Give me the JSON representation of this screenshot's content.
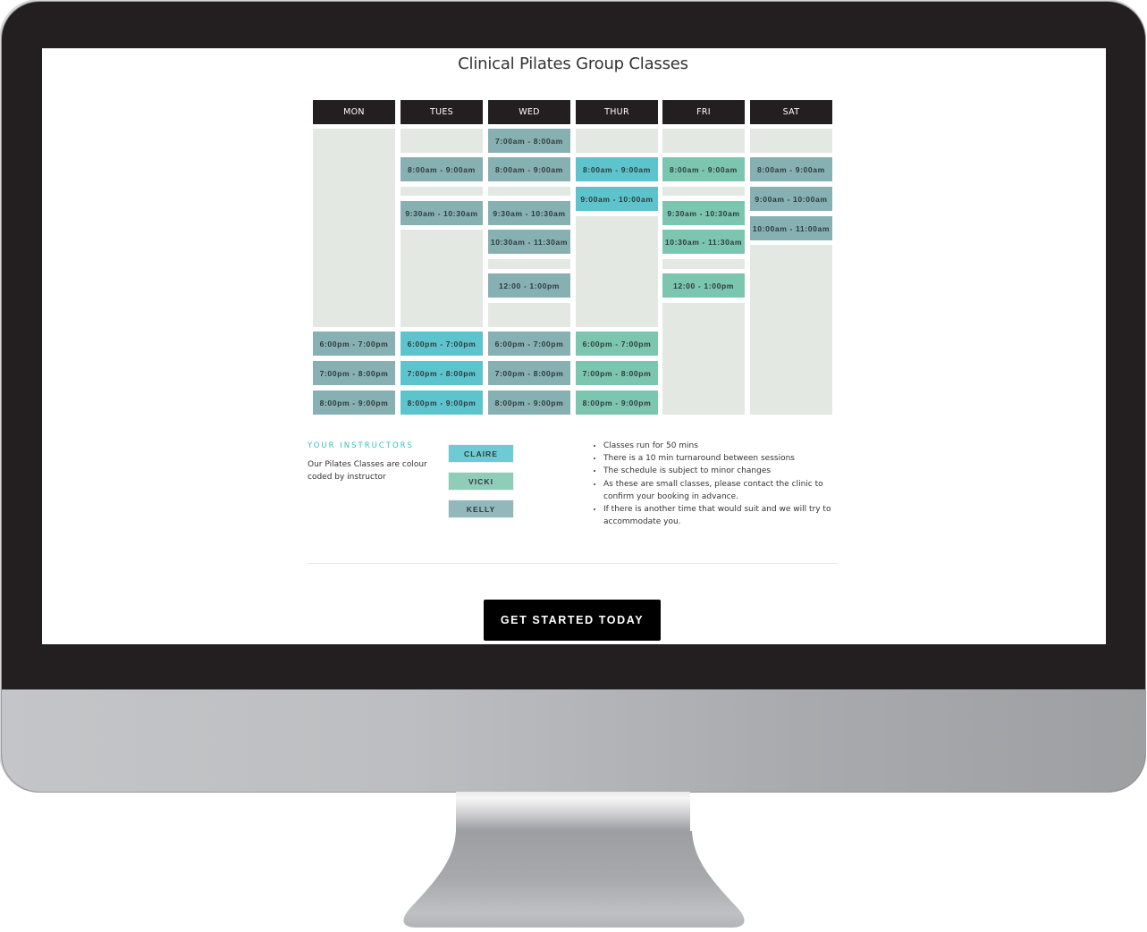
{
  "page": {
    "title": "Clinical Pilates Group Classes"
  },
  "instructors": {
    "heading": "YOUR INSTRUCTORS",
    "description": "Our Pilates Classes are colour coded by instructor",
    "legend": [
      {
        "name": "CLAIRE",
        "color": "#6ccbd3"
      },
      {
        "name": "VICKI",
        "color": "#8fcdb9"
      },
      {
        "name": "KELLY",
        "color": "#92b8bb"
      }
    ]
  },
  "instructor_colors": {
    "claire": "#5dc4cd",
    "vicki": "#7cc6b0",
    "kelly": "#86b0b2"
  },
  "empty_color": "#e3e8e3",
  "notes": [
    "Classes run for 50 mins",
    "There is a 10 min turnaround between sessions",
    "The schedule is subject to minor changes",
    "As these are small classes, please contact the clinic to confirm your booking in advance.",
    "If there is another time that would suit and we will try to accommodate you."
  ],
  "cta": {
    "label": "GET STARTED TODAY"
  },
  "timetable": {
    "days": [
      {
        "label": "MON",
        "slots": [
          {
            "row": "morning-block",
            "empty": true
          },
          {
            "row": "6pm",
            "time": "6:00pm - 7:00pm",
            "instructor": "kelly"
          },
          {
            "row": "7pm",
            "time": "7:00pm - 8:00pm",
            "instructor": "kelly"
          },
          {
            "row": "8pm",
            "time": "8:00pm - 9:00pm",
            "instructor": "kelly"
          }
        ]
      },
      {
        "label": "TUES",
        "slots": [
          {
            "row": "7am",
            "empty": true
          },
          {
            "row": "8am",
            "time": "8:00am - 9:00am",
            "instructor": "kelly"
          },
          {
            "row": "gap-9",
            "empty": true
          },
          {
            "row": "930am",
            "time": "9:30am - 10:30am",
            "instructor": "kelly"
          },
          {
            "row": "late-morning-block",
            "empty": true
          },
          {
            "row": "6pm",
            "time": "6:00pm - 7:00pm",
            "instructor": "claire"
          },
          {
            "row": "7pm",
            "time": "7:00pm - 8:00pm",
            "instructor": "claire"
          },
          {
            "row": "8pm",
            "time": "8:00pm - 9:00pm",
            "instructor": "claire"
          }
        ]
      },
      {
        "label": "WED",
        "slots": [
          {
            "row": "7am",
            "time": "7:00am - 8:00am",
            "instructor": "kelly"
          },
          {
            "row": "8am",
            "time": "8:00am - 9:00am",
            "instructor": "kelly"
          },
          {
            "row": "gap-9",
            "empty": true
          },
          {
            "row": "930am",
            "time": "9:30am - 10:30am",
            "instructor": "kelly"
          },
          {
            "row": "1030am",
            "time": "10:30am - 11:30am",
            "instructor": "kelly"
          },
          {
            "row": "gap-1130",
            "empty": true
          },
          {
            "row": "12pm",
            "time": "12:00 - 1:00pm",
            "instructor": "kelly"
          },
          {
            "row": "afternoon",
            "empty": true
          },
          {
            "row": "6pm",
            "time": "6:00pm - 7:00pm",
            "instructor": "kelly"
          },
          {
            "row": "7pm",
            "time": "7:00pm - 8:00pm",
            "instructor": "kelly"
          },
          {
            "row": "8pm",
            "time": "8:00pm - 9:00pm",
            "instructor": "kelly"
          }
        ]
      },
      {
        "label": "THUR",
        "slots": [
          {
            "row": "7am",
            "empty": true
          },
          {
            "row": "8am",
            "time": "8:00am - 9:00am",
            "instructor": "claire"
          },
          {
            "row": "9am",
            "time": "9:00am - 10:00am",
            "instructor": "claire"
          },
          {
            "row": "thur-midday-block",
            "empty": true
          },
          {
            "row": "6pm",
            "time": "6:00pm - 7:00pm",
            "instructor": "vicki"
          },
          {
            "row": "7pm",
            "time": "7:00pm - 8:00pm",
            "instructor": "vicki"
          },
          {
            "row": "8pm",
            "time": "8:00pm - 9:00pm",
            "instructor": "vicki"
          }
        ]
      },
      {
        "label": "FRI",
        "slots": [
          {
            "row": "7am",
            "empty": true
          },
          {
            "row": "8am",
            "time": "8:00am - 9:00am",
            "instructor": "vicki"
          },
          {
            "row": "gap-9",
            "empty": true
          },
          {
            "row": "930am",
            "time": "9:30am - 10:30am",
            "instructor": "vicki"
          },
          {
            "row": "1030am",
            "time": "10:30am - 11:30am",
            "instructor": "vicki"
          },
          {
            "row": "gap-1130",
            "empty": true
          },
          {
            "row": "12pm",
            "time": "12:00 - 1:00pm",
            "instructor": "vicki"
          },
          {
            "row": "fri-afternoon-evening",
            "empty": true
          }
        ]
      },
      {
        "label": "SAT",
        "slots": [
          {
            "row": "7am",
            "empty": true
          },
          {
            "row": "8am",
            "time": "8:00am - 9:00am",
            "instructor": "kelly"
          },
          {
            "row": "9am",
            "time": "9:00am - 10:00am",
            "instructor": "kelly"
          },
          {
            "row": "10am",
            "time": "10:00am - 11:00am",
            "instructor": "kelly"
          },
          {
            "row": "sat-rest",
            "empty": true
          }
        ]
      }
    ]
  }
}
